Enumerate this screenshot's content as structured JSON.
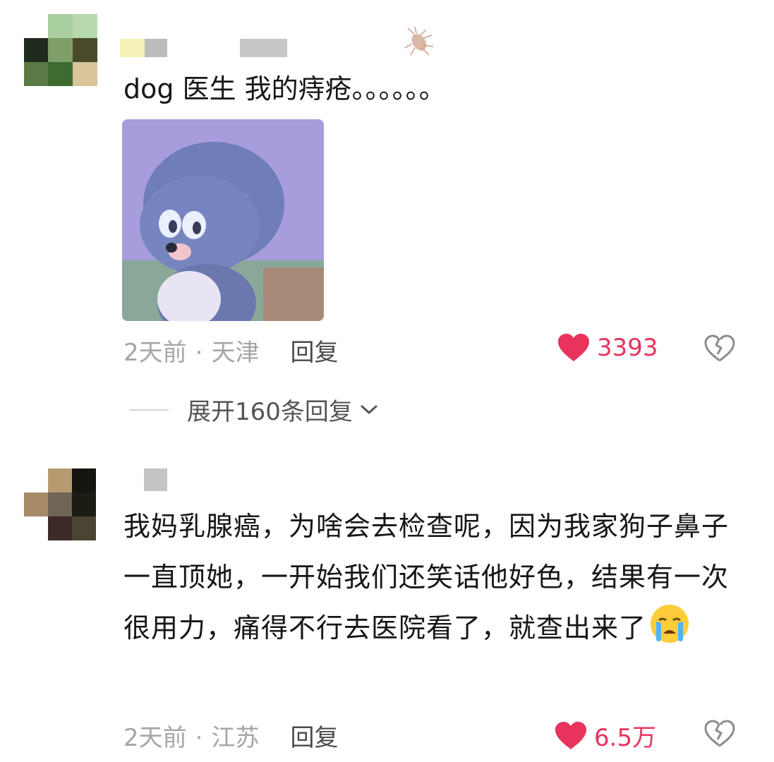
{
  "comments": [
    {
      "text": "dog 医生  我的痔疮。。。。。。",
      "time": "2天前",
      "location": "天津",
      "reply_label": "回复",
      "likes": "3393",
      "expand_label": "展开160条回复"
    },
    {
      "text": "我妈乳腺癌，为啥会去检查呢，因为我家狗子鼻子一直顶她，一开始我们还笑话他好色，结果有一次很用力，痛得不行去医院看了，就查出来了",
      "time": "2天前",
      "location": "江苏",
      "reply_label": "回复",
      "likes": "6.5万"
    }
  ],
  "colors": {
    "like": "#e8345c",
    "muted": "#a6a6a6",
    "text": "#161616"
  },
  "icons": [
    "heart-icon",
    "broken-heart-icon",
    "chevron-down-icon",
    "crying-emoji-icon",
    "cockroach-badge-icon"
  ]
}
